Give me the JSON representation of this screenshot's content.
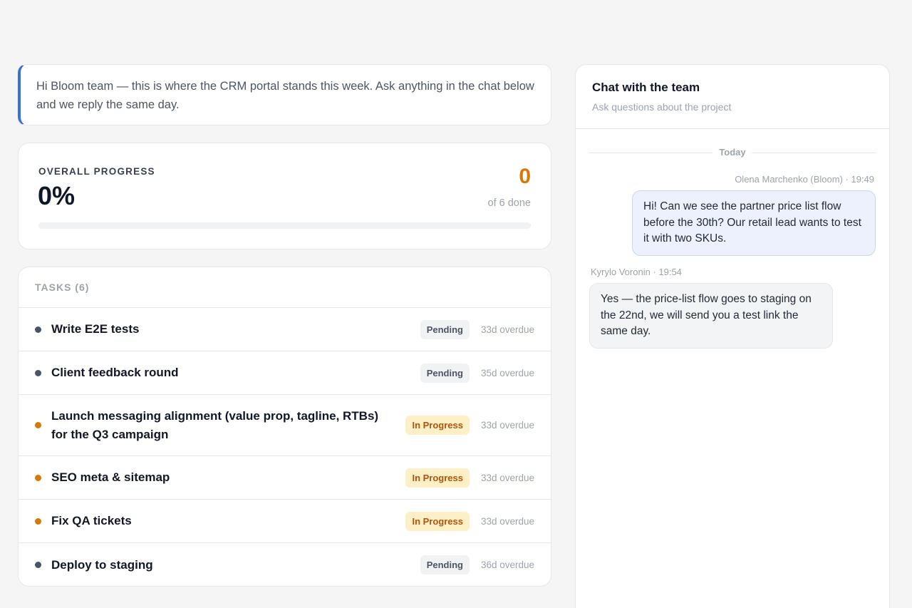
{
  "intro": {
    "message": "Hi Bloom team — this is where the CRM portal stands this week. Ask anything in the chat below and we reply the same day."
  },
  "progress": {
    "label": "OVERALL PROGRESS",
    "percent_text": "0%",
    "done_count": "0",
    "of_text": "of 6 done",
    "fraction": 0
  },
  "tasks": {
    "header": "TASKS (6)",
    "items": [
      {
        "title": "Write E2E tests",
        "status": "Pending",
        "overdue": "33d overdue"
      },
      {
        "title": "Client feedback round",
        "status": "Pending",
        "overdue": "35d overdue"
      },
      {
        "title": "Launch messaging alignment (value prop, tagline, RTBs) for the Q3 campaign",
        "status": "In Progress",
        "overdue": "33d overdue"
      },
      {
        "title": "SEO meta & sitemap",
        "status": "In Progress",
        "overdue": "33d overdue"
      },
      {
        "title": "Fix QA tickets",
        "status": "In Progress",
        "overdue": "33d overdue"
      },
      {
        "title": "Deploy to staging",
        "status": "Pending",
        "overdue": "36d overdue"
      }
    ]
  },
  "chat": {
    "title": "Chat with the team",
    "subtitle": "Ask questions about the project",
    "day_label": "Today",
    "messages": [
      {
        "author_meta": "Olena Marchenko (Bloom) · 19:49",
        "text": "Hi! Can we see the partner price list flow before the 30th? Our retail lead wants to test it with two SKUs."
      },
      {
        "author_meta": "Kyrylo Voronin · 19:54",
        "text": "Yes — the price-list flow goes to staging on the 22nd, we will send you a test link the same day."
      }
    ]
  },
  "colors": {
    "accent": "#3b6fd8",
    "progress_orange": "#d97706",
    "pending_dot": "#475569",
    "in_progress_badge_bg": "#fdf0c7"
  }
}
